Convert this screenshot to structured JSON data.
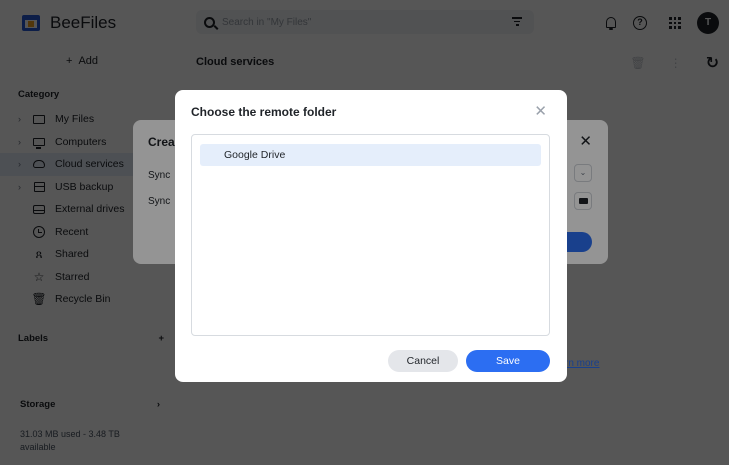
{
  "app": {
    "name": "BeeFiles",
    "avatar_letter": "T"
  },
  "search": {
    "placeholder": "Search in \"My Files\""
  },
  "sidebar": {
    "add_label": "Add",
    "category_title": "Category",
    "items": [
      {
        "label": "My Files",
        "icon": "folder-icon"
      },
      {
        "label": "Computers",
        "icon": "computer-icon"
      },
      {
        "label": "Cloud services",
        "icon": "cloud-icon"
      },
      {
        "label": "USB backup",
        "icon": "usb-icon"
      },
      {
        "label": "External drives",
        "icon": "drive-icon"
      },
      {
        "label": "Recent",
        "icon": "clock-icon"
      },
      {
        "label": "Shared",
        "icon": "people-icon"
      },
      {
        "label": "Starred",
        "icon": "star-icon"
      },
      {
        "label": "Recycle Bin",
        "icon": "trash-icon"
      }
    ],
    "labels_title": "Labels",
    "storage_title": "Storage",
    "storage_text": "31.03 MB used - 3.48 TB available"
  },
  "main": {
    "title": "Cloud services",
    "learn_more": "rn more"
  },
  "create_dialog": {
    "title": "Crea",
    "line1": "Sync",
    "line2": "Sync"
  },
  "remote_dialog": {
    "title": "Choose the remote folder",
    "items": [
      "Google Drive"
    ],
    "cancel_label": "Cancel",
    "save_label": "Save"
  },
  "colors": {
    "accent": "#2c6ef2",
    "selected_bg": "#e5eefb"
  }
}
